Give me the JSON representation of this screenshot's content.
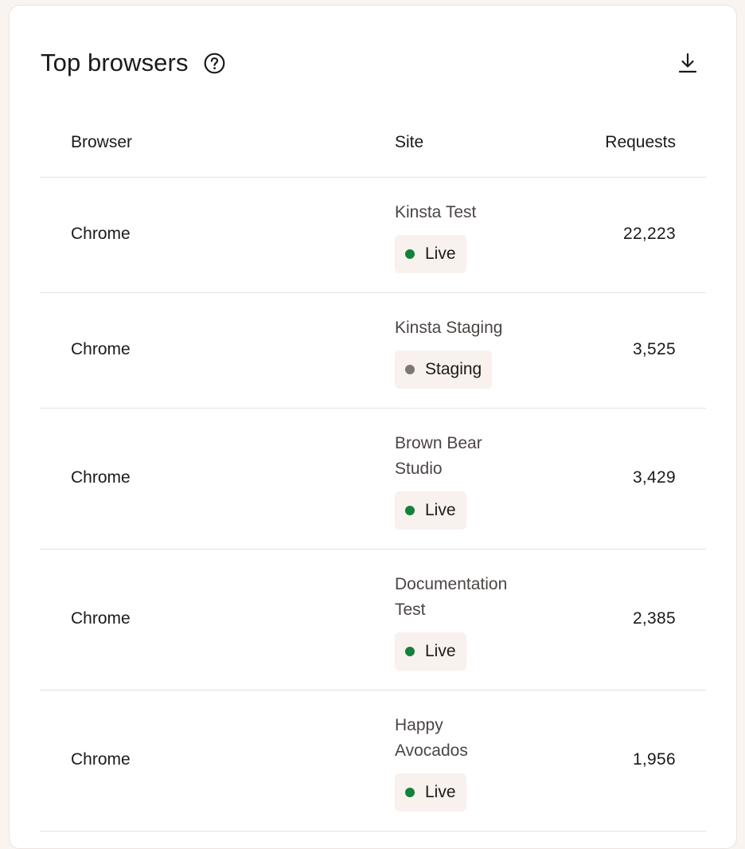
{
  "card": {
    "title": "Top browsers"
  },
  "icons": {
    "help": "question-circle-icon",
    "download": "download-icon"
  },
  "table": {
    "columns": [
      "Browser",
      "Site",
      "Requests"
    ],
    "rows": [
      {
        "browser": "Chrome",
        "site": "Kinsta Test",
        "environment": "Live",
        "requests": "22,223"
      },
      {
        "browser": "Chrome",
        "site": "Kinsta Staging",
        "environment": "Staging",
        "requests": "3,525"
      },
      {
        "browser": "Chrome",
        "site": "Brown Bear Studio",
        "environment": "Live",
        "requests": "3,429"
      },
      {
        "browser": "Chrome",
        "site": "Documentation Test",
        "environment": "Live",
        "requests": "2,385"
      },
      {
        "browser": "Chrome",
        "site": "Happy Avocados",
        "environment": "Live",
        "requests": "1,956"
      }
    ]
  },
  "colors": {
    "live_dot": "#12813c",
    "staging_dot": "#7d7775",
    "badge_bg": "#f8f1ed"
  }
}
